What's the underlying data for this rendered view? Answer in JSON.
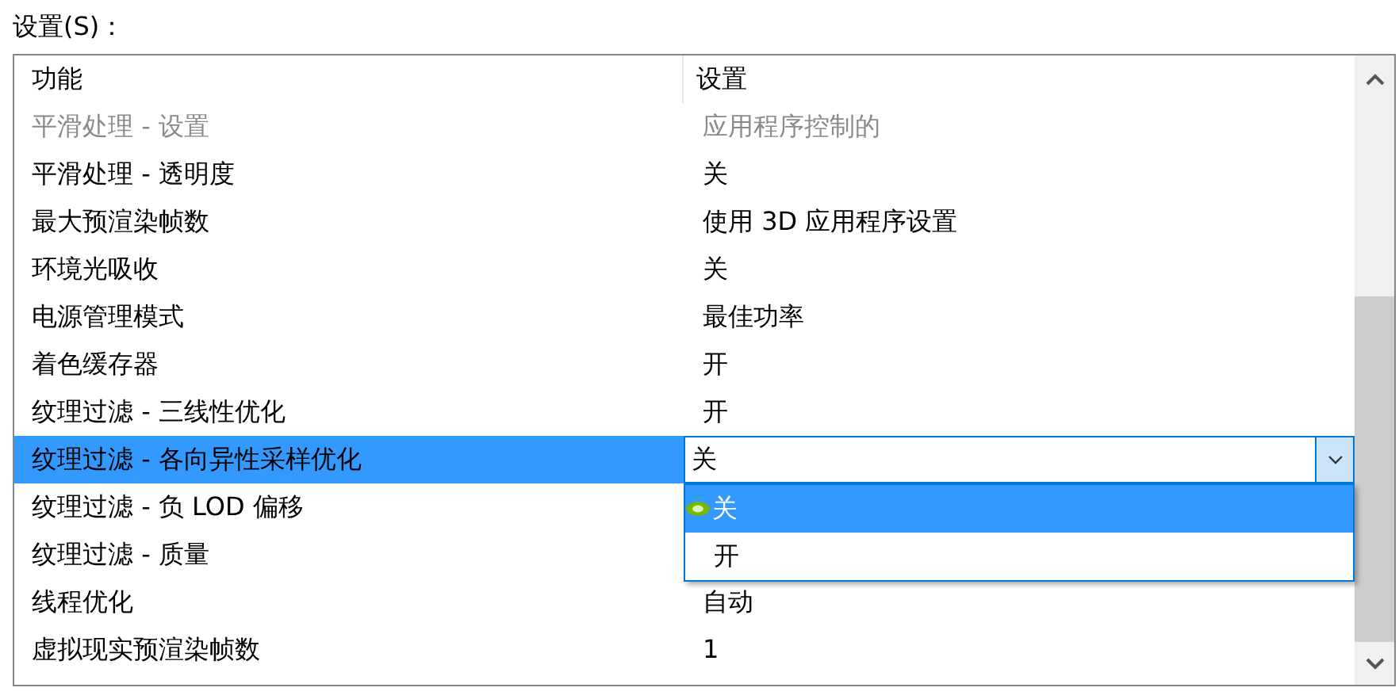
{
  "label": "设置(S)：",
  "table": {
    "columns": [
      "功能",
      "设置"
    ],
    "rows": [
      {
        "feature": "平滑处理 - 设置",
        "value": "应用程序控制的",
        "disabled": true,
        "selected": false
      },
      {
        "feature": "平滑处理 - 透明度",
        "value": "关",
        "disabled": false,
        "selected": false
      },
      {
        "feature": "最大预渲染帧数",
        "value": "使用 3D 应用程序设置",
        "disabled": false,
        "selected": false
      },
      {
        "feature": "环境光吸收",
        "value": "关",
        "disabled": false,
        "selected": false
      },
      {
        "feature": "电源管理模式",
        "value": "最佳功率",
        "disabled": false,
        "selected": false
      },
      {
        "feature": "着色缓存器",
        "value": "开",
        "disabled": false,
        "selected": false
      },
      {
        "feature": "纹理过滤 - 三线性优化",
        "value": "开",
        "disabled": false,
        "selected": false
      },
      {
        "feature": "纹理过滤 - 各向异性采样优化",
        "value": "关",
        "disabled": false,
        "selected": true
      },
      {
        "feature": "纹理过滤 - 负 LOD 偏移",
        "disabled": false,
        "selected": false
      },
      {
        "feature": "纹理过滤 - 质量",
        "disabled": false,
        "selected": false
      },
      {
        "feature": "线程优化",
        "value": "自动",
        "disabled": false,
        "selected": false
      },
      {
        "feature": "虚拟现实预渲染帧数",
        "value": "1",
        "disabled": false,
        "selected": false
      }
    ]
  },
  "dropdown": {
    "options": [
      {
        "label": "关",
        "selected": true
      },
      {
        "label": "开",
        "selected": false
      }
    ]
  }
}
